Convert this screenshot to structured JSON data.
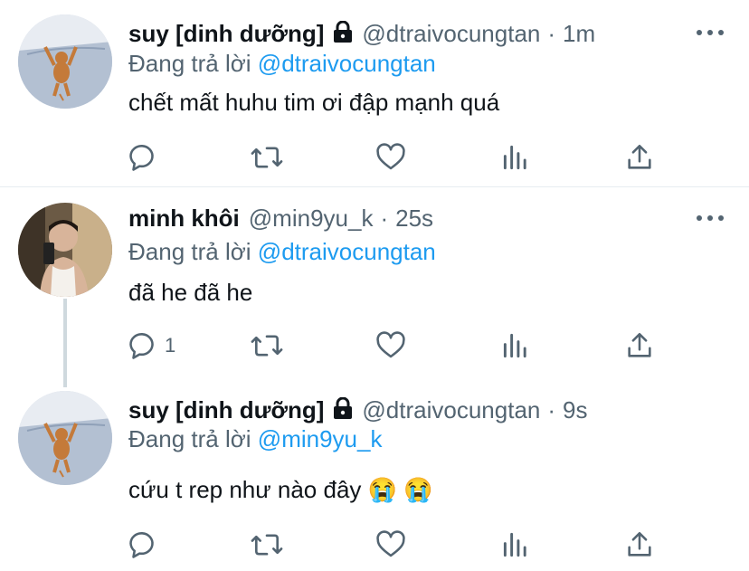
{
  "tweets": [
    {
      "name": "suy [dinh dưỡng]",
      "handle": "@dtraivocungtan",
      "separator": "·",
      "time": "1m",
      "reply_prefix": "Đang trả lời",
      "reply_to": "@dtraivocungtan",
      "text": "chết mất huhu tim ơi đập mạnh quá",
      "locked": true,
      "avatar": "cartoon-mouse-avatar",
      "reply_count": ""
    },
    {
      "name": "minh khôi",
      "handle": "@min9yu_k",
      "separator": "·",
      "time": "25s",
      "reply_prefix": "Đang trả lời",
      "reply_to": "@dtraivocungtan",
      "text": "đã he đã he",
      "locked": false,
      "avatar": "selfie-avatar",
      "reply_count": "1"
    },
    {
      "name": "suy [dinh dưỡng]",
      "handle": "@dtraivocungtan",
      "separator": "·",
      "time": "9s",
      "reply_prefix": "Đang trả lời",
      "reply_to": "@min9yu_k",
      "text": "cứu t rep như nào đây 😭 😭",
      "locked": true,
      "avatar": "cartoon-mouse-avatar",
      "reply_count": ""
    }
  ],
  "icons": {
    "reply": "reply-icon",
    "retweet": "retweet-icon",
    "like": "like-icon",
    "views": "views-icon",
    "share": "share-icon",
    "more": "more-icon",
    "lock": "lock-icon"
  },
  "colors": {
    "text": "#0f1419",
    "secondary": "#536471",
    "link": "#1d9bf0",
    "divider": "#e6ecf0"
  }
}
